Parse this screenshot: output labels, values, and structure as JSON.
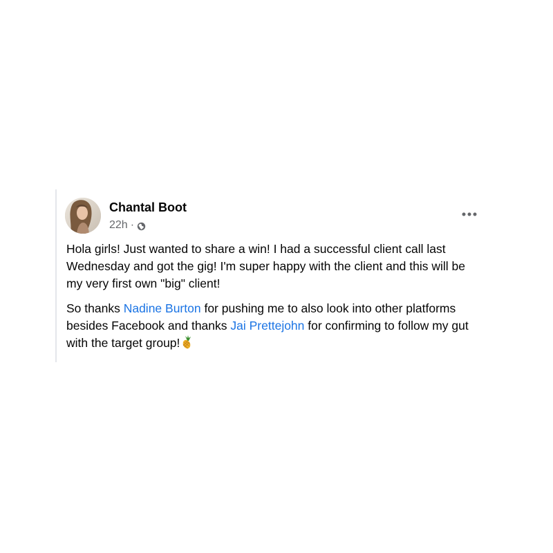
{
  "post": {
    "author": "Chantal Boot",
    "timestamp": "22h",
    "separator": "·",
    "audience_icon": "globe-icon",
    "more_icon": "more-options-icon",
    "paragraph1": "Hola girls! Just wanted to share a win! I had a successful client call last Wednesday and got the gig! I'm super happy with the client and this will be my very first own \"big\" client!",
    "paragraph2": {
      "part1": "So thanks ",
      "mention1": "Nadine Burton",
      "part2": " for pushing me to also look into other platforms besides Facebook and thanks ",
      "mention2": "Jai Prettejohn",
      "part3": " for confirming to follow my gut with the target group!",
      "emoji": "pineapple-emoji"
    }
  },
  "colors": {
    "mention": "#1b74e4",
    "meta_text": "#65676b",
    "body_text": "#050505"
  }
}
